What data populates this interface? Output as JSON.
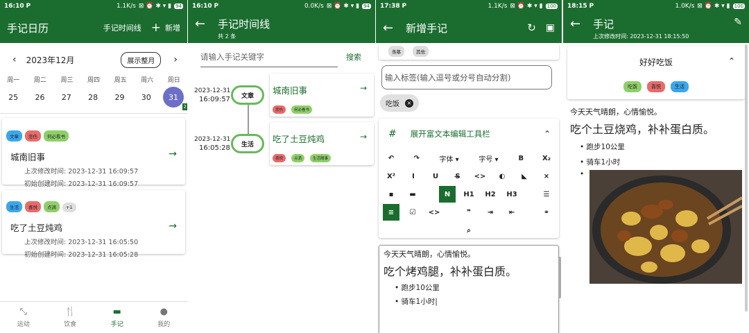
{
  "p1": {
    "time": "16:10",
    "net": "1.1K/s",
    "batt": "94",
    "title": "手记日历",
    "timeline": "手记时间线",
    "add": "新增",
    "month": "2023年12月",
    "show_month": "展示整月",
    "weekdays": [
      "周一",
      "周二",
      "周三",
      "周四",
      "周五",
      "周六",
      "周日"
    ],
    "days": [
      "25",
      "26",
      "27",
      "28",
      "29",
      "30",
      "31"
    ],
    "badge": "2",
    "entries": [
      {
        "tags": [
          {
            "t": "文章",
            "c": "t-blue"
          },
          {
            "t": "悲伤",
            "c": "t-red"
          },
          {
            "t": "何必看书",
            "c": "t-green"
          }
        ],
        "title": "城南旧事",
        "mod": "上次修改时间: 2023-12-31 16:09:57",
        "created": "初始创建时间: 2023-12-31 16:09:57"
      },
      {
        "tags": [
          {
            "t": "生活",
            "c": "t-blue"
          },
          {
            "t": "喜悦",
            "c": "t-red"
          },
          {
            "t": "点滴",
            "c": "t-green"
          },
          {
            "t": "+1",
            "c": "t-gray"
          }
        ],
        "title": "吃了土豆炖鸡",
        "mod": "上次修改时间: 2023-12-31 16:05:50",
        "created": "初始创建时间: 2023-12-31 16:05:28"
      }
    ],
    "nav": [
      "运动",
      "饮食",
      "手记",
      "我的"
    ]
  },
  "p2": {
    "time": "16:10",
    "net": "0.0K/s",
    "batt": "94",
    "title": "手记时间线",
    "sub": "共 2 条",
    "search_ph": "请输入手记关键字",
    "search": "搜索",
    "items": [
      {
        "date": "2023-12-31",
        "clock": "16:09:57",
        "cat": "文章",
        "title": "城南旧事",
        "tags": [
          {
            "t": "悲伤",
            "c": "t-red"
          },
          {
            "t": "何必看书",
            "c": "t-green"
          }
        ]
      },
      {
        "date": "2023-12-31",
        "clock": "16:05:28",
        "cat": "生活",
        "title": "吃了土豆炖鸡",
        "tags": [
          {
            "t": "喜悦",
            "c": "t-red"
          },
          {
            "t": "点滴",
            "c": "t-green"
          },
          {
            "t": "生活随事",
            "c": "t-green"
          }
        ]
      }
    ]
  },
  "p3": {
    "time": "17:38",
    "net": "1.1K/s",
    "batt": "100",
    "title": "新增手记",
    "toptags": [
      "羡慕",
      "其他"
    ],
    "tag_ph": "输入标签(输入逗号或分号自动分割)",
    "chip": "吃饭",
    "rich": "展开富文本编辑工具栏",
    "font": "字体",
    "size": "字号",
    "editor": {
      "line1": "今天天气晴朗，心情愉悦。",
      "line2": "吃个烤鸡腿，补补蛋白质。",
      "b1": "跑步10公里",
      "b2": "骑车1小时"
    }
  },
  "p4": {
    "time": "18:15",
    "net": "1.0K/s",
    "batt": "100",
    "title": "手记",
    "mod": "上次修改时间: 2023-12-31 18:15:50",
    "note_title": "好好吃饭",
    "tags": [
      {
        "t": "吃饭",
        "c": "t-green"
      },
      {
        "t": "喜悦",
        "c": "t-red"
      },
      {
        "t": "生活",
        "c": "t-blue"
      }
    ],
    "line1": "今天天气晴朗，心情愉悦。",
    "line2": "吃个土豆烧鸡，补补蛋白质。",
    "b1": "跑步10公里",
    "b2": "骑车1小时"
  }
}
